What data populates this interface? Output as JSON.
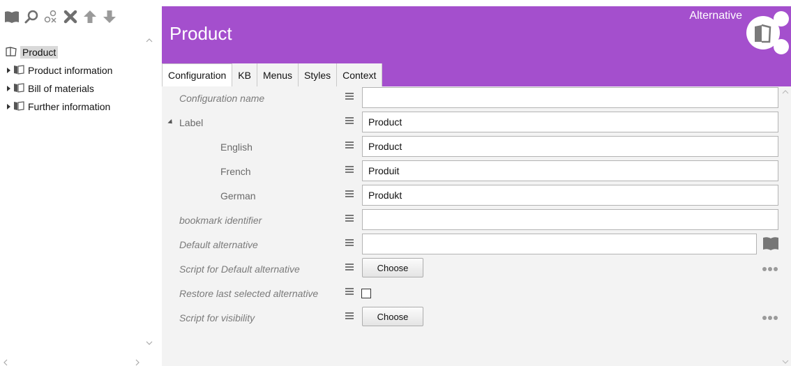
{
  "toolbar": {
    "icons": [
      "book-icon",
      "search-icon",
      "link-icon",
      "delete-icon",
      "up-arrow-icon",
      "down-arrow-icon"
    ]
  },
  "tree": {
    "root": "Product",
    "children": [
      "Product information",
      "Bill of materials",
      "Further information"
    ]
  },
  "header": {
    "title": "Product",
    "alternative_label": "Alternative",
    "color": "#a44fcd"
  },
  "tabs": [
    {
      "label": "Configuration",
      "active": true
    },
    {
      "label": "KB",
      "active": false
    },
    {
      "label": "Menus",
      "active": false
    },
    {
      "label": "Styles",
      "active": false
    },
    {
      "label": "Context",
      "active": false
    }
  ],
  "form": {
    "configuration_name": {
      "label": "Configuration name",
      "value": ""
    },
    "label": {
      "label": "Label",
      "value": "Product"
    },
    "english": {
      "label": "English",
      "value": "Product"
    },
    "french": {
      "label": "French",
      "value": "Produit"
    },
    "german": {
      "label": "German",
      "value": "Produkt"
    },
    "bookmark_identifier": {
      "label": "bookmark identifier",
      "value": ""
    },
    "default_alternative": {
      "label": "Default alternative",
      "value": ""
    },
    "script_default_alternative": {
      "label": "Script for Default alternative",
      "button": "Choose"
    },
    "restore_last": {
      "label": "Restore last selected alternative",
      "checked": false
    },
    "script_visibility": {
      "label": "Script for visibility",
      "button": "Choose"
    }
  }
}
